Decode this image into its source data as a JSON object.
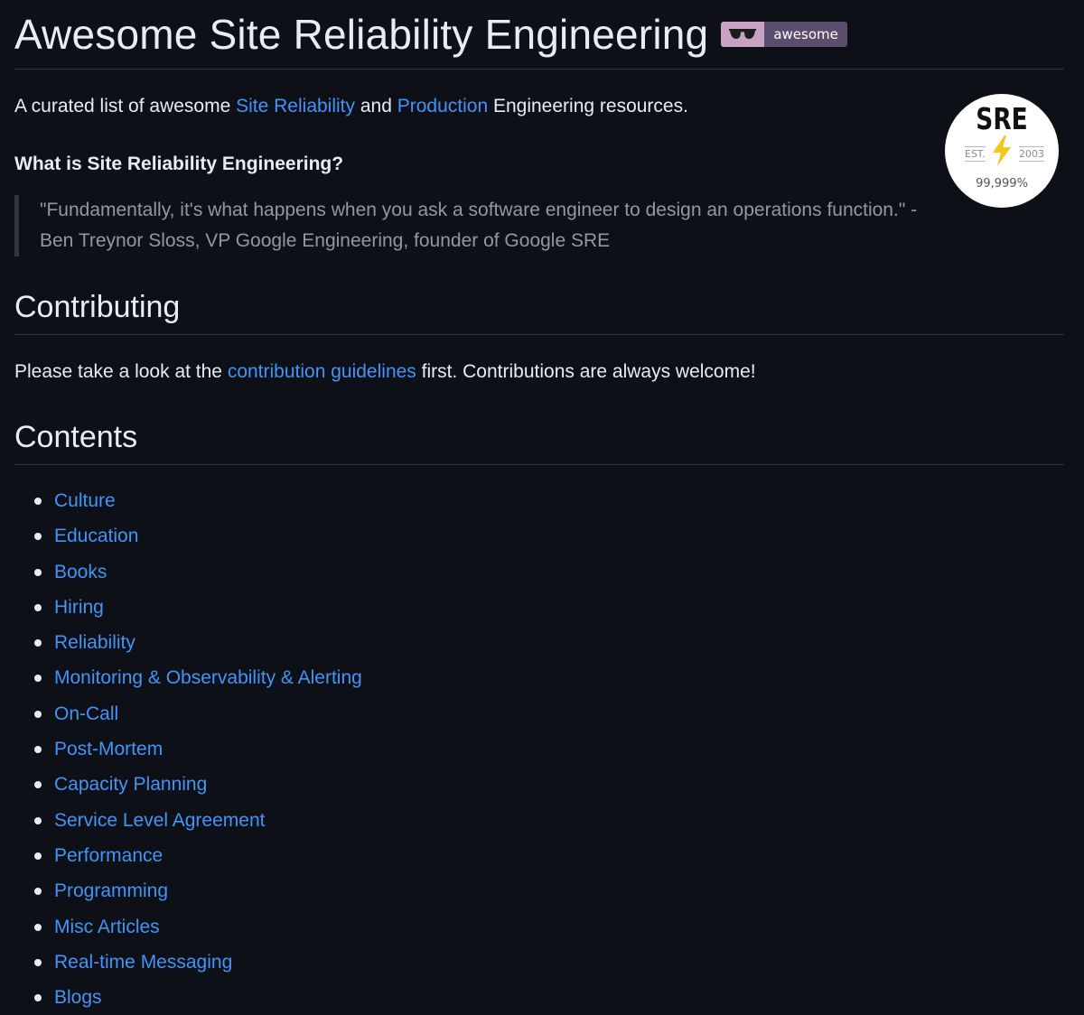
{
  "header": {
    "title": "Awesome Site Reliability Engineering",
    "badge_text": "awesome",
    "badge_icon": "sunglasses-icon"
  },
  "intro": {
    "prefix": "A curated list of awesome ",
    "link1": "Site Reliability",
    "middle": " and ",
    "link2": "Production",
    "suffix": " Engineering resources."
  },
  "logo": {
    "title": "SRE",
    "est": "EST.",
    "year": "2003",
    "nines": "99,999%",
    "bolt_color": "#f5c518"
  },
  "question": "What is Site Reliability Engineering?",
  "quote": "\"Fundamentally, it's what happens when you ask a software engineer to design an operations function.\" - Ben Treynor Sloss, VP Google Engineering, founder of Google SRE",
  "contributing": {
    "heading": "Contributing",
    "prefix": "Please take a look at the ",
    "link": "contribution guidelines",
    "suffix": " first. Contributions are always welcome!"
  },
  "contents": {
    "heading": "Contents",
    "items": [
      "Culture",
      "Education",
      "Books",
      "Hiring",
      "Reliability",
      "Monitoring & Observability & Alerting",
      "On-Call",
      "Post-Mortem",
      "Capacity Planning",
      "Service Level Agreement",
      "Performance",
      "Programming",
      "Misc Articles",
      "Real-time Messaging",
      "Blogs"
    ]
  },
  "colors": {
    "background": "#0d1117",
    "text": "#e6edf3",
    "link": "#4493f8",
    "muted": "#9198a1",
    "border": "#30363d"
  }
}
